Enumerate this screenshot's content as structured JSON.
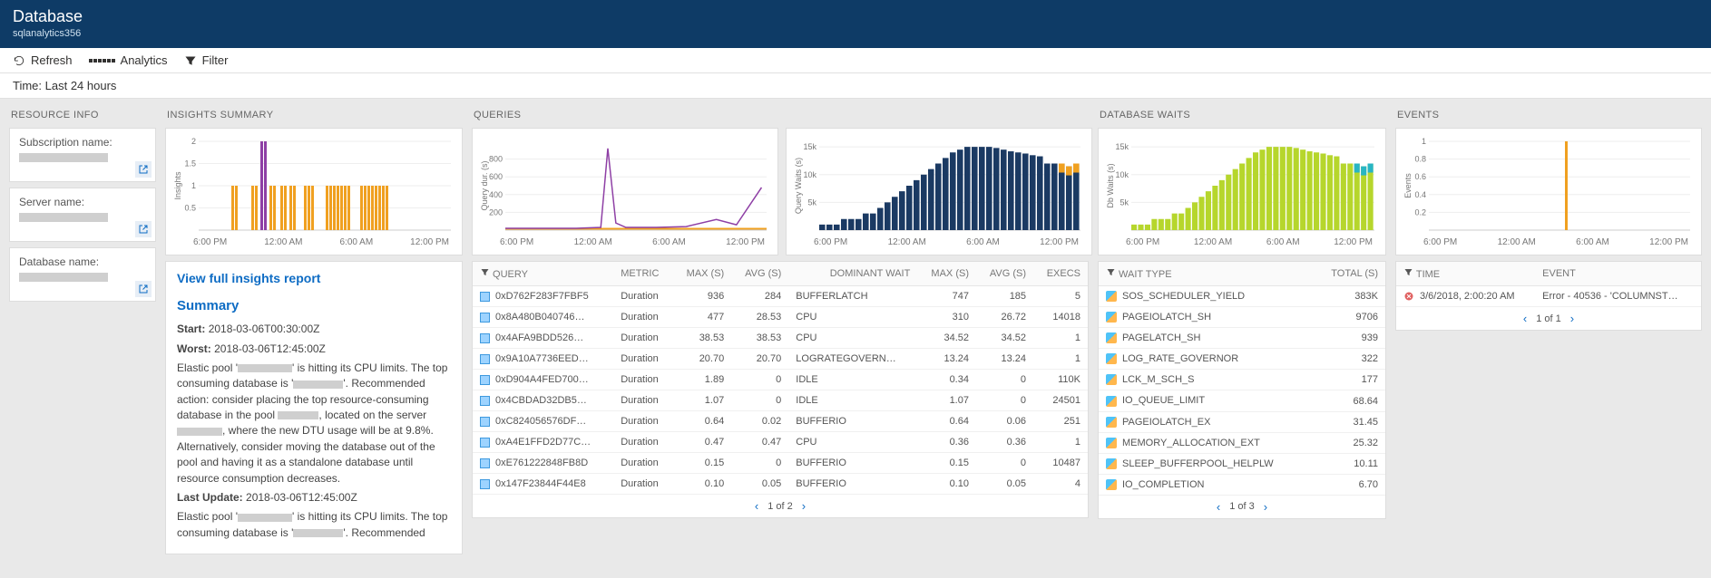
{
  "header": {
    "title": "Database",
    "subtitle": "sqlanalytics356"
  },
  "toolbar": {
    "refresh": "Refresh",
    "analytics": "Analytics",
    "filter": "Filter"
  },
  "timebar": "Time: Last 24 hours",
  "resource_info": {
    "title": "RESOURCE INFO",
    "cards": [
      {
        "label": "Subscription name:"
      },
      {
        "label": "Server name:"
      },
      {
        "label": "Database name:"
      }
    ]
  },
  "insights": {
    "title": "INSIGHTS SUMMARY",
    "link": "View full insights report",
    "summary_heading": "Summary",
    "start_label": "Start:",
    "start_value": "2018-03-06T00:30:00Z",
    "worst_label": "Worst:",
    "worst_value": "2018-03-06T12:45:00Z",
    "para1_a": "Elastic pool '",
    "para1_b": "' is hitting its CPU limits. The top consuming database is '",
    "para1_c": "'. Recommended action: consider placing the top resource-consuming database in the pool ",
    "para1_d": ", located on the server ",
    "para1_e": ", where the new DTU usage will be at 9.8%. Alternatively, consider moving the database out of the pool and having it as a standalone database until resource consumption decreases.",
    "last_update_label": "Last Update:",
    "last_update_value": "2018-03-06T12:45:00Z",
    "para2_a": "Elastic pool '",
    "para2_b": "' is hitting its CPU limits. The top consuming database is '",
    "para2_c": "'. Recommended"
  },
  "queries": {
    "title": "QUERIES",
    "headers": [
      "QUERY",
      "METRIC",
      "MAX (S)",
      "AVG (S)",
      "DOMINANT WAIT",
      "MAX (S)",
      "AVG (S)",
      "EXECS"
    ],
    "rows": [
      [
        "0xD762F283F7FBF5",
        "Duration",
        "936",
        "284",
        "BUFFERLATCH",
        "747",
        "185",
        "5"
      ],
      [
        "0x8A480B040746…",
        "Duration",
        "477",
        "28.53",
        "CPU",
        "310",
        "26.72",
        "14018"
      ],
      [
        "0x4AFA9BDD526…",
        "Duration",
        "38.53",
        "38.53",
        "CPU",
        "34.52",
        "34.52",
        "1"
      ],
      [
        "0x9A10A7736EED…",
        "Duration",
        "20.70",
        "20.70",
        "LOGRATEGOVERN…",
        "13.24",
        "13.24",
        "1"
      ],
      [
        "0xD904A4FED700…",
        "Duration",
        "1.89",
        "0",
        "IDLE",
        "0.34",
        "0",
        "110K"
      ],
      [
        "0x4CBDAD32DB5…",
        "Duration",
        "1.07",
        "0",
        "IDLE",
        "1.07",
        "0",
        "24501"
      ],
      [
        "0xC824056576DF…",
        "Duration",
        "0.64",
        "0.02",
        "BUFFERIO",
        "0.64",
        "0.06",
        "251"
      ],
      [
        "0xA4E1FFD2D77C…",
        "Duration",
        "0.47",
        "0.47",
        "CPU",
        "0.36",
        "0.36",
        "1"
      ],
      [
        "0xE761222848FB8D",
        "Duration",
        "0.15",
        "0",
        "BUFFERIO",
        "0.15",
        "0",
        "10487"
      ],
      [
        "0x147F23844F44E8",
        "Duration",
        "0.10",
        "0.05",
        "BUFFERIO",
        "0.10",
        "0.05",
        "4"
      ]
    ],
    "pager": "1 of 2"
  },
  "waits": {
    "title": "DATABASE WAITS",
    "headers": [
      "WAIT TYPE",
      "TOTAL (S)"
    ],
    "rows": [
      [
        "SOS_SCHEDULER_YIELD",
        "383K"
      ],
      [
        "PAGEIOLATCH_SH",
        "9706"
      ],
      [
        "PAGELATCH_SH",
        "939"
      ],
      [
        "LOG_RATE_GOVERNOR",
        "322"
      ],
      [
        "LCK_M_SCH_S",
        "177"
      ],
      [
        "IO_QUEUE_LIMIT",
        "68.64"
      ],
      [
        "PAGEIOLATCH_EX",
        "31.45"
      ],
      [
        "MEMORY_ALLOCATION_EXT",
        "25.32"
      ],
      [
        "SLEEP_BUFFERPOOL_HELPLW",
        "10.11"
      ],
      [
        "IO_COMPLETION",
        "6.70"
      ]
    ],
    "pager": "1 of 3"
  },
  "events": {
    "title": "EVENTS",
    "headers": [
      "TIME",
      "EVENT"
    ],
    "rows": [
      [
        "3/6/2018, 2:00:20 AM",
        "Error - 40536 - 'COLUMNST…"
      ]
    ],
    "pager": "1 of 1"
  },
  "xticks_full": [
    "6:00 PM",
    "12:00 AM",
    "6:00 AM",
    "12:00 PM"
  ],
  "chart_data": [
    {
      "type": "bar",
      "name": "insights",
      "ylabel": "Insights",
      "ylim": [
        0,
        2
      ],
      "yticks": [
        0.5,
        1,
        1.5,
        2
      ],
      "xticks": [
        "6:00 PM",
        "12:00 AM",
        "6:00 AM",
        "12:00 PM"
      ],
      "bars": [
        {
          "x": 36,
          "h": 1,
          "c": "#f0a020"
        },
        {
          "x": 40,
          "h": 1,
          "c": "#f0a020"
        },
        {
          "x": 58,
          "h": 1,
          "c": "#f0a020"
        },
        {
          "x": 62,
          "h": 1,
          "c": "#f0a020"
        },
        {
          "x": 68,
          "h": 2,
          "c": "#8e3fa5"
        },
        {
          "x": 72,
          "h": 2,
          "c": "#8e3fa5"
        },
        {
          "x": 78,
          "h": 1,
          "c": "#f0a020"
        },
        {
          "x": 82,
          "h": 1,
          "c": "#f0a020"
        },
        {
          "x": 90,
          "h": 1,
          "c": "#f0a020"
        },
        {
          "x": 94,
          "h": 1,
          "c": "#f0a020"
        },
        {
          "x": 100,
          "h": 1,
          "c": "#f0a020"
        },
        {
          "x": 104,
          "h": 1,
          "c": "#f0a020"
        },
        {
          "x": 116,
          "h": 1,
          "c": "#f0a020"
        },
        {
          "x": 120,
          "h": 1,
          "c": "#f0a020"
        },
        {
          "x": 124,
          "h": 1,
          "c": "#f0a020"
        },
        {
          "x": 140,
          "h": 1,
          "c": "#f0a020"
        },
        {
          "x": 144,
          "h": 1,
          "c": "#f0a020"
        },
        {
          "x": 148,
          "h": 1,
          "c": "#f0a020"
        },
        {
          "x": 152,
          "h": 1,
          "c": "#f0a020"
        },
        {
          "x": 156,
          "h": 1,
          "c": "#f0a020"
        },
        {
          "x": 160,
          "h": 1,
          "c": "#f0a020"
        },
        {
          "x": 164,
          "h": 1,
          "c": "#f0a020"
        },
        {
          "x": 178,
          "h": 1,
          "c": "#f0a020"
        },
        {
          "x": 182,
          "h": 1,
          "c": "#f0a020"
        },
        {
          "x": 186,
          "h": 1,
          "c": "#f0a020"
        },
        {
          "x": 190,
          "h": 1,
          "c": "#f0a020"
        },
        {
          "x": 194,
          "h": 1,
          "c": "#f0a020"
        },
        {
          "x": 198,
          "h": 1,
          "c": "#f0a020"
        },
        {
          "x": 202,
          "h": 1,
          "c": "#f0a020"
        },
        {
          "x": 206,
          "h": 1,
          "c": "#f0a020"
        }
      ]
    },
    {
      "type": "line",
      "name": "query_duration",
      "ylabel": "Query dur. (s)",
      "ylim": [
        0,
        1000
      ],
      "yticks": [
        200,
        400,
        600,
        800
      ],
      "xticks": [
        "6:00 PM",
        "12:00 AM",
        "6:00 AM",
        "12:00 PM"
      ],
      "series": {
        "color": "#8e3fa5",
        "points": [
          [
            0,
            20
          ],
          [
            40,
            20
          ],
          [
            70,
            20
          ],
          [
            95,
            30
          ],
          [
            102,
            920
          ],
          [
            110,
            80
          ],
          [
            120,
            30
          ],
          [
            150,
            30
          ],
          [
            180,
            40
          ],
          [
            210,
            120
          ],
          [
            230,
            60
          ],
          [
            255,
            480
          ]
        ]
      },
      "baseline": {
        "color": "#f0a020",
        "y": 15
      }
    },
    {
      "type": "bar",
      "name": "query_waits",
      "ylabel": "Query Waits (s)",
      "ylim": [
        0,
        16000
      ],
      "yticks": [
        5000,
        10000,
        15000
      ],
      "xticks": [
        "6:00 PM",
        "12:00 AM",
        "6:00 AM",
        "12:00 PM"
      ],
      "bars_profile": {
        "color": "#1b3a63",
        "accent": "#f0a020",
        "accent2": "#4fc3f7",
        "heights": [
          1,
          1,
          1,
          2,
          2,
          2,
          3,
          3,
          4,
          5,
          6,
          7,
          8,
          9,
          10,
          11,
          12,
          13,
          14,
          14.5,
          15,
          15,
          15,
          15,
          14.8,
          14.5,
          14.2,
          14,
          13.8,
          13.5,
          13.3,
          12,
          12,
          12,
          11.5,
          12
        ]
      }
    },
    {
      "type": "bar",
      "name": "db_waits",
      "ylabel": "Db Waits (s)",
      "ylim": [
        0,
        16000
      ],
      "yticks": [
        5000,
        10000,
        15000
      ],
      "xticks": [
        "6:00 PM",
        "12:00 AM",
        "6:00 AM",
        "12:00 PM"
      ],
      "bars_profile": {
        "color": "#b6d62c",
        "accent": "#28b5c4",
        "heights": [
          1,
          1,
          1,
          2,
          2,
          2,
          3,
          3,
          4,
          5,
          6,
          7,
          8,
          9,
          10,
          11,
          12,
          13,
          14,
          14.5,
          15,
          15,
          15,
          15,
          14.8,
          14.5,
          14.2,
          14,
          13.8,
          13.5,
          13.3,
          12,
          12,
          12,
          11.5,
          12
        ]
      }
    },
    {
      "type": "bar",
      "name": "events",
      "ylabel": "Events",
      "ylim": [
        0,
        1
      ],
      "yticks": [
        0.2,
        0.4,
        0.6,
        0.8,
        1
      ],
      "xticks": [
        "6:00 PM",
        "12:00 AM",
        "6:00 AM",
        "12:00 PM"
      ],
      "bars": [
        {
          "x": 150,
          "h": 1,
          "c": "#f0a020"
        }
      ]
    }
  ]
}
